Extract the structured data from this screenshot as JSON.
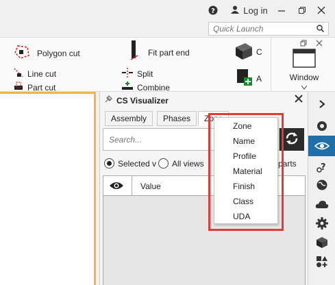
{
  "titlebar": {
    "help_icon": "help-icon",
    "login_label": "Log in",
    "quick_launch_placeholder": "Quick Launch"
  },
  "ribbon": {
    "polygon_cut": "Polygon cut",
    "fit_part_end": "Fit part end",
    "line_cut": "Line cut",
    "split": "Split",
    "part_cut": "Part cut",
    "combine": "Combine",
    "window": "Window",
    "c_label": "C",
    "a_label": "A"
  },
  "panel": {
    "title": "CS Visualizer",
    "tabs": [
      "Assembly",
      "Phases",
      "Zone"
    ],
    "search_placeholder": "Search...",
    "radio_selected_label": "Selected v",
    "radio_all_label": "All views",
    "parts_label": "parts",
    "column_value": "Value"
  },
  "dropdown": {
    "items": [
      "Zone",
      "Name",
      "Profile",
      "Material",
      "Finish",
      "Class",
      "UDA"
    ]
  },
  "colors": {
    "accent": "#1f6fa8",
    "highlight": "#e53935",
    "view_border": "#f3b34a"
  }
}
